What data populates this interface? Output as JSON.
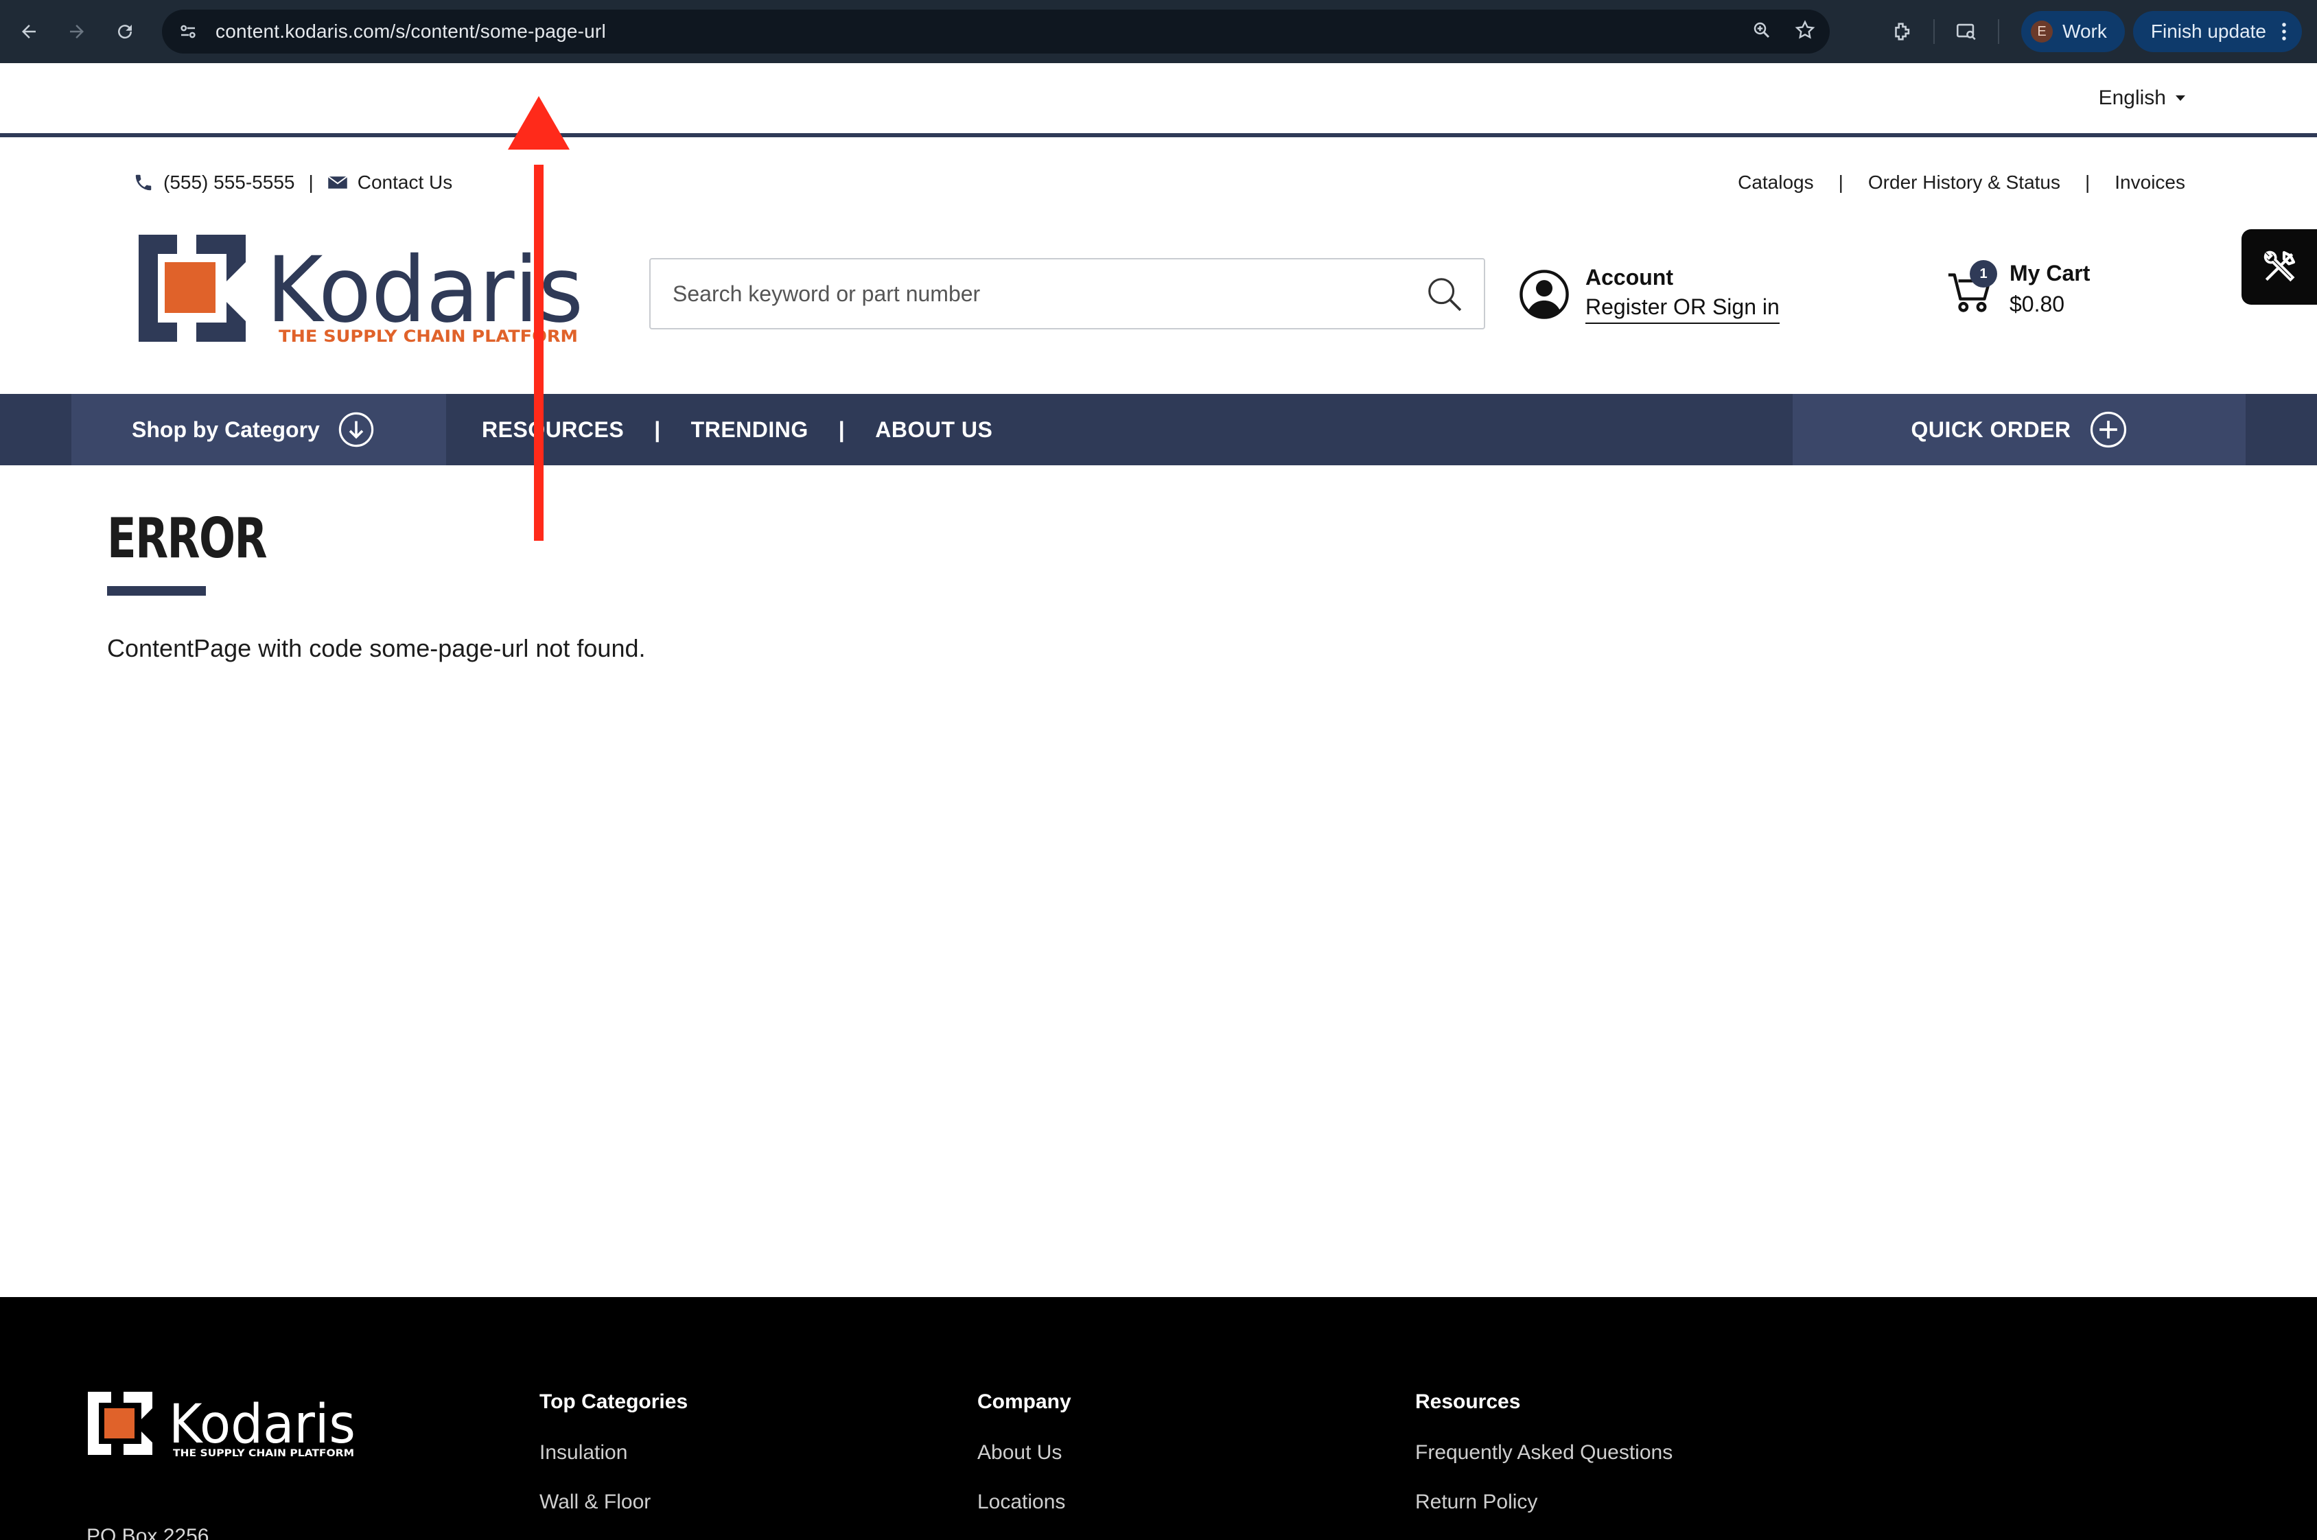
{
  "browser": {
    "url": "content.kodaris.com/s/content/some-page-url",
    "profile_initial": "E",
    "profile_name": "Work",
    "update_label": "Finish update"
  },
  "language": {
    "selected": "English"
  },
  "utility": {
    "phone": "(555) 555-5555",
    "separator": "|",
    "contact": "Contact Us",
    "links": [
      "Catalogs",
      "|",
      "Order History & Status",
      "|",
      "Invoices"
    ]
  },
  "logo": {
    "name": "Kodaris",
    "tagline": "THE SUPPLY CHAIN PLATFORM"
  },
  "search": {
    "placeholder": "Search keyword or part number"
  },
  "account": {
    "title": "Account",
    "action": "Register OR Sign in"
  },
  "cart": {
    "title": "My Cart",
    "total": "$0.80",
    "count": "1"
  },
  "nav": {
    "shop_by_category": "Shop by Category",
    "links": [
      "RESOURCES",
      "|",
      "TRENDING",
      "|",
      "ABOUT US"
    ],
    "quick_order": "QUICK ORDER"
  },
  "error": {
    "title": "ERROR",
    "message": "ContentPage with code some-page-url not found."
  },
  "footer": {
    "logo_name": "Kodaris",
    "logo_tagline": "THE SUPPLY CHAIN PLATFORM",
    "address": "PO Box 2256",
    "columns": [
      {
        "title": "Top Categories",
        "items": [
          "Insulation",
          "Wall & Floor"
        ]
      },
      {
        "title": "Company",
        "items": [
          "About Us",
          "Locations"
        ]
      },
      {
        "title": "Resources",
        "items": [
          "Frequently Asked Questions",
          "Return Policy"
        ]
      }
    ]
  },
  "colors": {
    "navy": "#2f3a57",
    "navy_light": "#3b4769",
    "orange": "#e0622a",
    "annotation_red": "#ff2a1a"
  }
}
